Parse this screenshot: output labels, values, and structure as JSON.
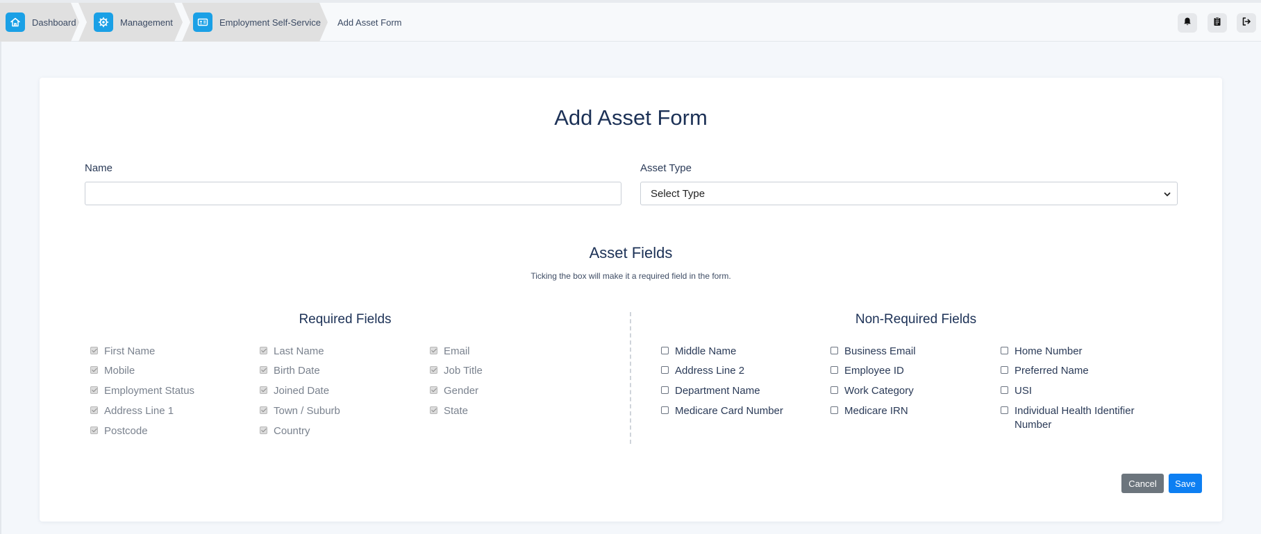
{
  "breadcrumb": {
    "items": [
      {
        "label": "Dashboard",
        "icon": "home-icon"
      },
      {
        "label": "Management",
        "icon": "gear-icon"
      },
      {
        "label": "Employment Self-Service",
        "icon": "id-card-icon"
      }
    ],
    "current": "Add Asset Form"
  },
  "toolbar": {
    "icons": [
      "bell-icon",
      "clipboard-icon",
      "logout-icon"
    ]
  },
  "form": {
    "title": "Add Asset Form",
    "name_label": "Name",
    "name_value": "",
    "asset_type_label": "Asset Type",
    "asset_type_selected": "Select Type"
  },
  "asset_fields": {
    "title": "Asset Fields",
    "subtitle": "Ticking the box will make it a required field in the form.",
    "required_title": "Required Fields",
    "non_required_title": "Non-Required Fields",
    "required": [
      [
        "First Name",
        "Last Name",
        "Email"
      ],
      [
        "Mobile",
        "Birth Date",
        "Job Title"
      ],
      [
        "Employment Status",
        "Joined Date",
        "Gender"
      ],
      [
        "Address Line 1",
        "Town / Suburb",
        "State"
      ],
      [
        "Postcode",
        "Country"
      ]
    ],
    "non_required": [
      [
        "Middle Name",
        "Business Email",
        "Home Number"
      ],
      [
        "Address Line 2",
        "Employee ID",
        "Preferred Name"
      ],
      [
        "Department Name",
        "Work Category",
        "USI"
      ],
      [
        "Medicare Card Number",
        "Medicare IRN",
        "Individual Health Identifier Number"
      ]
    ]
  },
  "actions": {
    "cancel_label": "Cancel",
    "save_label": "Save"
  },
  "colors": {
    "accent": "#1aa0e6",
    "primary_button": "#0d7ff2",
    "secondary_button": "#6c757d",
    "title_text": "#1c3156"
  }
}
